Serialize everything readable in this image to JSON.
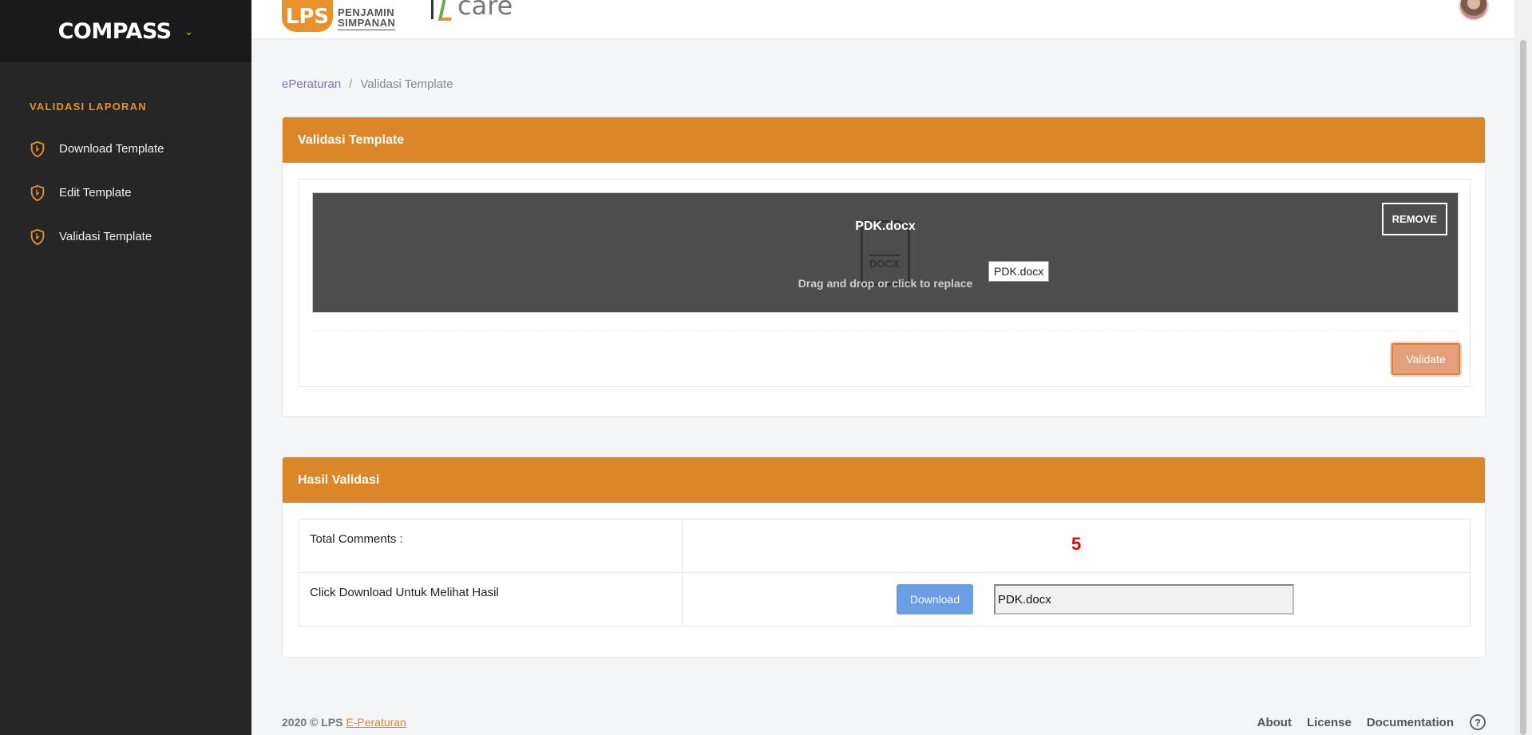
{
  "sidebar": {
    "brand": "COMPASS",
    "section_title": "VALIDASI LAPORAN",
    "items": [
      {
        "label": "Download Template"
      },
      {
        "label": "Edit Template"
      },
      {
        "label": "Validasi Template"
      }
    ]
  },
  "topbar": {
    "lps_mark": "LPS",
    "lps_line1": "PENJAMIN",
    "lps_line2": "SIMPANAN",
    "care_text": "care"
  },
  "breadcrumb": {
    "root": "ePeraturan",
    "separator": "/",
    "current": "Validasi Template"
  },
  "validasi_card": {
    "title": "Validasi Template",
    "file_name": "PDK.docx",
    "file_ext": "DOCX",
    "hint": "Drag and drop or click to replace",
    "tooltip": "PDK.docx",
    "remove_label": "REMOVE",
    "validate_label": "Validate"
  },
  "hasil_card": {
    "title": "Hasil Validasi",
    "total_label": "Total Comments :",
    "total_value": "5",
    "download_label_text": "Click Download Untuk Melihat Hasil",
    "download_button": "Download",
    "download_file": "PDK.docx"
  },
  "footer": {
    "copyright": "2020 © LPS",
    "link": "E-Peraturan",
    "links": [
      "About",
      "License",
      "Documentation"
    ],
    "help": "?"
  },
  "colors": {
    "accent": "#db8628",
    "sidebar_bg": "#262626",
    "total_value": "#e00000",
    "download_button": "#6a9de3"
  }
}
